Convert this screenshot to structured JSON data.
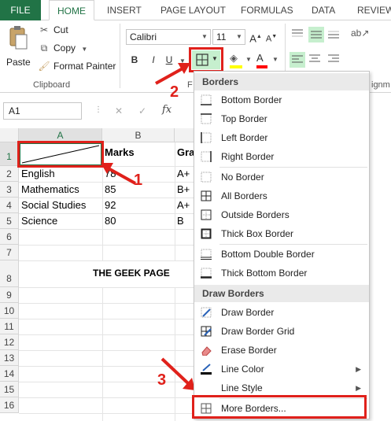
{
  "tabs": [
    "FILE",
    "HOME",
    "INSERT",
    "PAGE LAYOUT",
    "FORMULAS",
    "DATA",
    "REVIEW"
  ],
  "clipboard": {
    "paste": "Paste",
    "cut": "Cut",
    "copy": "Copy",
    "format_painter": "Format Painter",
    "group_label": "Clipboard"
  },
  "font": {
    "name": "Calibri",
    "size": "11",
    "group_label_partial": "F",
    "bold": "B",
    "italic": "I",
    "underline": "U",
    "font_color_letter": "A",
    "grow": "A",
    "shrink": "A"
  },
  "alignment_group_label_partial": "ignm",
  "formula_bar": {
    "name_box": "A1",
    "cancel": "✕",
    "enter": "✓",
    "fx": "fx"
  },
  "columns": [
    "A",
    "B"
  ],
  "col_c_partial": "",
  "rows": [
    "1",
    "2",
    "3",
    "4",
    "5",
    "6",
    "7",
    "8",
    "9",
    "10",
    "11",
    "12",
    "13",
    "14",
    "15",
    "16"
  ],
  "cells": {
    "b1": "Marks",
    "c1": "Gra",
    "a2": "English",
    "b2": "78",
    "c2": "A+",
    "a3": "Mathematics",
    "b3": "85",
    "c3": "B+",
    "a4": "Social Studies",
    "b4": "92",
    "c4": "A+",
    "a5": "Science",
    "b5": "80",
    "c5": "B",
    "title": "THE GEEK PAGE"
  },
  "menu": {
    "borders_header": "Borders",
    "items": [
      "Bottom Border",
      "Top Border",
      "Left Border",
      "Right Border",
      "No Border",
      "All Borders",
      "Outside Borders",
      "Thick Box Border",
      "Bottom Double Border",
      "Thick Bottom Border"
    ],
    "draw_header": "Draw Borders",
    "draw_items": [
      "Draw Border",
      "Draw Border Grid",
      "Erase Border",
      "Line Color",
      "Line Style",
      "More Borders..."
    ]
  },
  "callouts": [
    "1",
    "2",
    "3"
  ],
  "colors": {
    "excel_green": "#217346",
    "highlight_red": "#e0211b",
    "selected_green": "#c6efce"
  }
}
